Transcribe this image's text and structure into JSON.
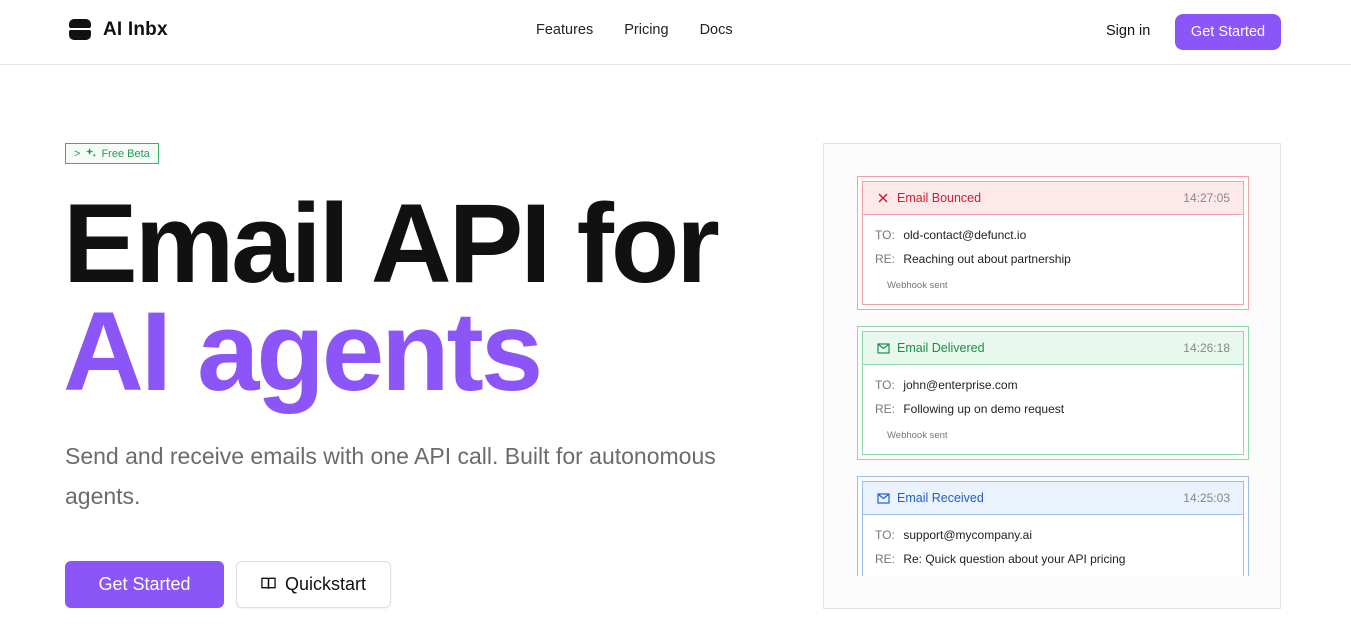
{
  "brand": {
    "name": "AI Inbx"
  },
  "nav": {
    "items": [
      "Features",
      "Pricing",
      "Docs"
    ]
  },
  "header": {
    "signin": "Sign in",
    "cta": "Get Started"
  },
  "hero": {
    "badge_prefix": ">",
    "badge_label": "Free Beta",
    "title_line1": "Email API for",
    "title_line2": "AI agents",
    "subtitle": "Send and receive emails with one API call. Built for autonomous agents.",
    "primary_cta": "Get Started",
    "secondary_cta": "Quickstart"
  },
  "feed": {
    "to_label": "TO:",
    "re_label": "RE:",
    "events": [
      {
        "status": "Email Bounced",
        "time": "14:27:05",
        "to": "old-contact@defunct.io",
        "re": "Reaching out about partnership",
        "note": "Webhook sent",
        "icon": "x-icon",
        "color": "#c42431"
      },
      {
        "status": "Email Delivered",
        "time": "14:26:18",
        "to": "john@enterprise.com",
        "re": "Following up on demo request",
        "note": "Webhook sent",
        "icon": "mail-sent-icon",
        "color": "#1e8f4a"
      },
      {
        "status": "Email Received",
        "time": "14:25:03",
        "to": "support@mycompany.ai",
        "re": "Re: Quick question about your API pricing",
        "note": "",
        "icon": "mail-icon",
        "color": "#2260c4"
      }
    ]
  },
  "colors": {
    "accent": "#8b55f7",
    "badge_green": "#35b26b"
  }
}
